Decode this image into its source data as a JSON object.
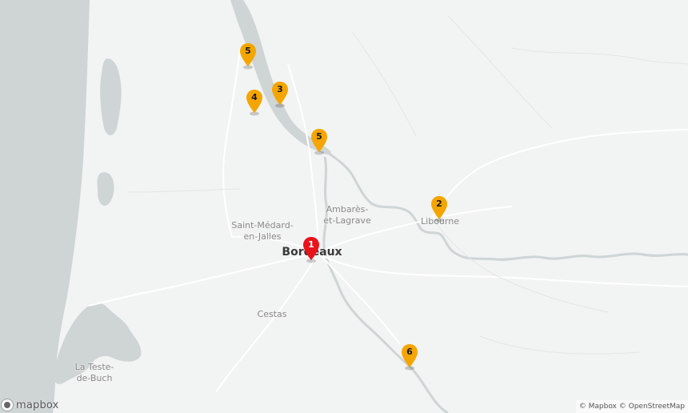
{
  "map": {
    "colors": {
      "land": "#f2f3f3",
      "water": "#cfd4d5",
      "road": "#ffffff",
      "marker_primary": "#e8141c",
      "marker_secondary": "#f5a500"
    },
    "labels": {
      "saint_medard": "Saint-Médard-\nen-Jalles",
      "bordeaux": "Bordeaux",
      "ambares": "Ambarès-\net-Lagrave",
      "libourne": "Libourne",
      "cestas": "Cestas",
      "la_teste": "La Teste-\nde-Buch"
    },
    "markers": [
      {
        "id": "1",
        "label": "1",
        "type": "primary",
        "icon": "map-pin-icon"
      },
      {
        "id": "2",
        "label": "2",
        "type": "secondary",
        "icon": "map-pin-icon"
      },
      {
        "id": "3",
        "label": "3",
        "type": "secondary",
        "icon": "map-pin-icon"
      },
      {
        "id": "4",
        "label": "4",
        "type": "secondary",
        "icon": "map-pin-icon"
      },
      {
        "id": "5a",
        "label": "5",
        "type": "secondary",
        "icon": "map-pin-icon"
      },
      {
        "id": "5b",
        "label": "5",
        "type": "secondary",
        "icon": "map-pin-icon"
      },
      {
        "id": "6",
        "label": "6",
        "type": "secondary",
        "icon": "map-pin-icon"
      }
    ]
  },
  "logo": {
    "text": "mapbox",
    "icon": "mapbox-logo-icon"
  },
  "attribution": {
    "mapbox": "© Mapbox",
    "osm": "© OpenStreetMap"
  }
}
